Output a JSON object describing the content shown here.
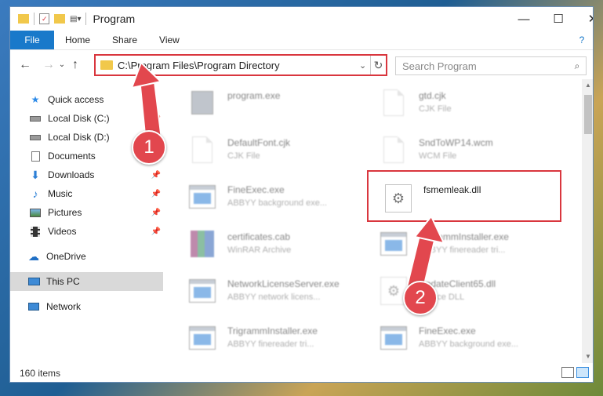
{
  "window": {
    "title": "Program",
    "minimize_glyph": "—",
    "maximize_glyph": "☐",
    "close_glyph": "✕"
  },
  "ribbon": {
    "file": "File",
    "tabs": [
      "Home",
      "Share",
      "View"
    ],
    "help_glyph": "?"
  },
  "address_bar": {
    "back_glyph": "←",
    "forward_glyph": "→",
    "dropdown_glyph": "⌄",
    "up_glyph": "↑",
    "path": "C:\\Program Files\\Program Directory",
    "refresh_glyph": "↻",
    "chevron_glyph": "⌄",
    "search_placeholder": "Search Program",
    "search_glyph": "⌕"
  },
  "sidebar": {
    "items": [
      {
        "label": "Quick access",
        "icon": "star-icon"
      },
      {
        "label": "Local Disk (C:)",
        "icon": "drive-icon"
      },
      {
        "label": "Local Disk (D:)",
        "icon": "drive-icon"
      },
      {
        "label": "Documents",
        "icon": "documents-icon"
      },
      {
        "label": "Downloads",
        "icon": "downloads-icon"
      },
      {
        "label": "Music",
        "icon": "music-icon"
      },
      {
        "label": "Pictures",
        "icon": "pictures-icon"
      },
      {
        "label": "Videos",
        "icon": "videos-icon"
      },
      {
        "label": "OneDrive",
        "icon": "cloud-icon"
      },
      {
        "label": "This PC",
        "icon": "computer-icon"
      },
      {
        "label": "Network",
        "icon": "network-icon"
      }
    ],
    "pin_glyph": "📌"
  },
  "files": [
    {
      "name": "program.exe",
      "type": ""
    },
    {
      "name": "gtd.cjk",
      "type": "CJK File"
    },
    {
      "name": "DefaultFont.cjk",
      "type": "CJK File"
    },
    {
      "name": "SndToWP14.wcm",
      "type": "WCM File"
    },
    {
      "name": "FineExec.exe",
      "type": "ABBYY background exe..."
    },
    {
      "name": "fsmemleak.dll",
      "type": ""
    },
    {
      "name": "certificates.cab",
      "type": "WinRAR Archive"
    },
    {
      "name": "TrigrammInstaller.exe",
      "type": "ABBYY finereader tri..."
    },
    {
      "name": "NetworkLicenseServer.exe",
      "type": "ABBYY network licens..."
    },
    {
      "name": "UpdateClient65.dll",
      "type": "Source DLL"
    },
    {
      "name": "TrigrammInstaller.exe",
      "type": "ABBYY finereader tri..."
    },
    {
      "name": "FineExec.exe",
      "type": "ABBYY background exe..."
    }
  ],
  "status": {
    "count": "160 items"
  },
  "callouts": [
    "1",
    "2"
  ],
  "colors": {
    "accent": "#1979ca",
    "highlight": "#d9363e",
    "callout": "#e2474e"
  }
}
